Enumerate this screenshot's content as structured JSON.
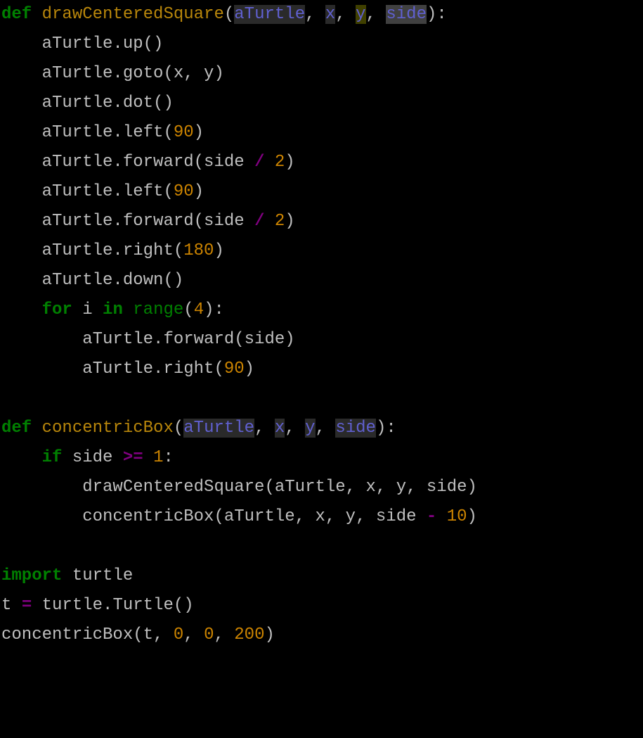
{
  "code": {
    "l1": {
      "def": "def",
      "sp": " ",
      "fn": "drawCenteredSquare",
      "p": "(",
      "a": "aTurtle",
      "c1": ", ",
      "x": "x",
      "c2": ", ",
      "y": "y",
      "c3": ", ",
      "s": "side",
      "close": "):"
    },
    "l2": "    aTurtle.up()",
    "l3": "    aTurtle.goto(x, y)",
    "l4": "    aTurtle.dot()",
    "l5": {
      "pre": "    aTurtle.left(",
      "n": "90",
      "post": ")"
    },
    "l6": {
      "pre": "    aTurtle.forward(side ",
      "op": "/",
      "sp": " ",
      "n": "2",
      "post": ")"
    },
    "l7": {
      "pre": "    aTurtle.left(",
      "n": "90",
      "post": ")"
    },
    "l8": {
      "pre": "    aTurtle.forward(side ",
      "op": "/",
      "sp": " ",
      "n": "2",
      "post": ")"
    },
    "l9": {
      "pre": "    aTurtle.right(",
      "n": "180",
      "post": ")"
    },
    "l10": "    aTurtle.down()",
    "l11": {
      "ind": "    ",
      "for": "for",
      "sp1": " ",
      "i": "i",
      "sp2": " ",
      "in": "in",
      "sp3": " ",
      "rng": "range",
      "p": "(",
      "n": "4",
      "post": "):"
    },
    "l12": "        aTurtle.forward(side)",
    "l13": {
      "pre": "        aTurtle.right(",
      "n": "90",
      "post": ")"
    },
    "l14": "",
    "l15": {
      "def": "def",
      "sp": " ",
      "fn": "concentricBox",
      "p": "(",
      "a": "aTurtle",
      "c1": ", ",
      "x": "x",
      "c2": ", ",
      "y": "y",
      "c3": ", ",
      "s": "side",
      "close": "):"
    },
    "l16": {
      "ind": "    ",
      "if": "if",
      "sp": " side ",
      "op": ">=",
      "sp2": " ",
      "n": "1",
      "post": ":"
    },
    "l17": "        drawCenteredSquare(aTurtle, x, y, side)",
    "l18": {
      "pre": "        concentricBox(aTurtle, x, y, side ",
      "op": "-",
      "sp": " ",
      "n": "10",
      "post": ")"
    },
    "l19": "",
    "l20": {
      "imp": "import",
      "sp": " ",
      "mod": "turtle"
    },
    "l21": {
      "t": "t ",
      "op": "=",
      "post": " turtle.Turtle()"
    },
    "l22": {
      "pre": "concentricBox(t, ",
      "n1": "0",
      "c1": ", ",
      "n2": "0",
      "c2": ", ",
      "n3": "200",
      "post": ")"
    }
  }
}
